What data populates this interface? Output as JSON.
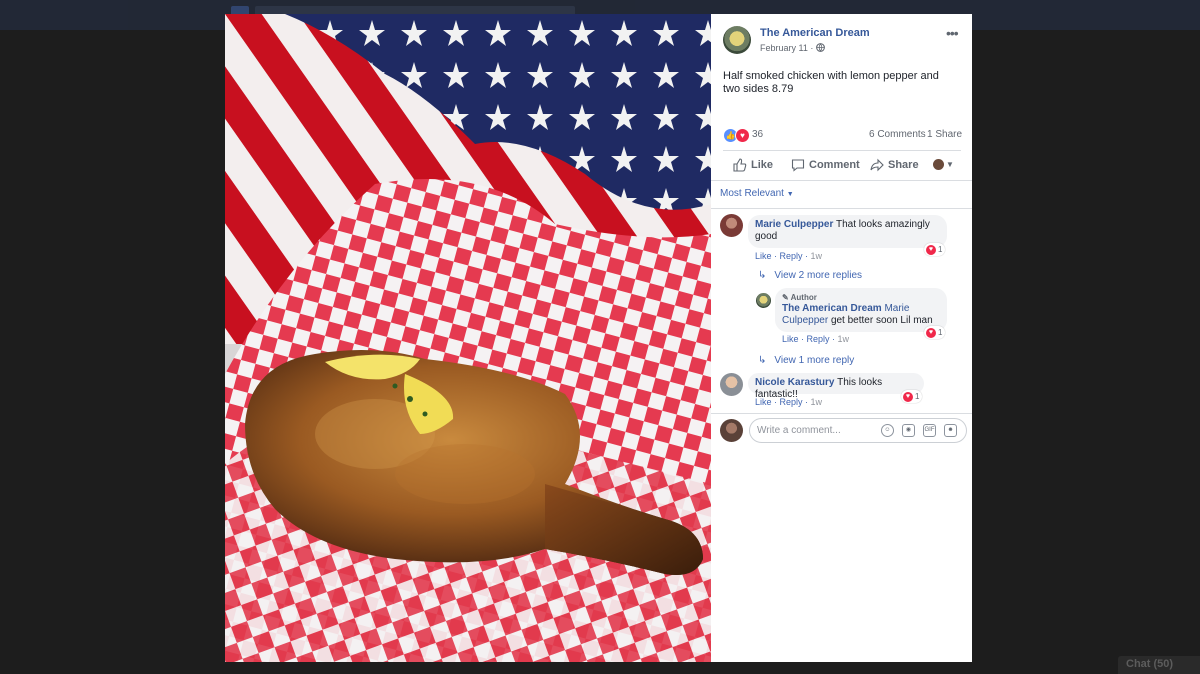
{
  "page": {
    "name": "The American Dream",
    "date": "February 11",
    "post_text": "Half smoked chicken with lemon pepper and two sides 8.79"
  },
  "reactions": {
    "count": "36",
    "comments": "6 Comments",
    "shares": "1 Share"
  },
  "actions": {
    "like": "Like",
    "comment": "Comment",
    "share": "Share"
  },
  "sort": {
    "label": "Most Relevant"
  },
  "comments": [
    {
      "author": "Marie Culpepper",
      "text": "That looks amazingly good",
      "like": "Like",
      "reply": "Reply",
      "time": "1w",
      "hearts": "1",
      "more_replies": "View 2 more replies"
    },
    {
      "badge": "Author",
      "author": "The American Dream",
      "mention": "Marie Culpepper",
      "text": "get better soon Lil man",
      "like": "Like",
      "reply": "Reply",
      "time": "1w",
      "hearts": "1",
      "more_replies": "View 1 more reply"
    },
    {
      "author": "Nicole Karastury",
      "text": "This looks fantastic!!",
      "like": "Like",
      "reply": "Reply",
      "time": "1w",
      "hearts": "1"
    }
  ],
  "composer": {
    "placeholder": "Write a comment..."
  },
  "chat": {
    "label": "Chat (50)"
  },
  "colors": {
    "link": "#365899",
    "accent": "#4267b2",
    "love": "#f0284a",
    "like": "#5890ff"
  }
}
